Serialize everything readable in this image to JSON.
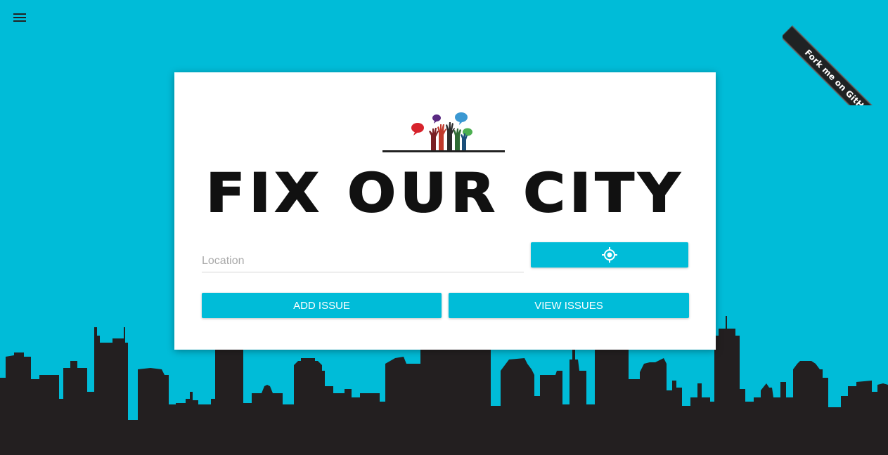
{
  "app": {
    "title": "FIX OUR CITY"
  },
  "header": {
    "menu_icon": "hamburger-menu-icon"
  },
  "ribbon": {
    "label": "Fork me on GitHub",
    "color": "#1f2223"
  },
  "form": {
    "location_placeholder": "Location",
    "location_value": "",
    "locate_icon": "gps-locate-icon",
    "add_issue_label": "ADD ISSUE",
    "view_issues_label": "VIEW ISSUES"
  },
  "theme": {
    "accent": "#00BCD8",
    "skyline": "#231F20",
    "card_background": "#FFFFFF"
  }
}
